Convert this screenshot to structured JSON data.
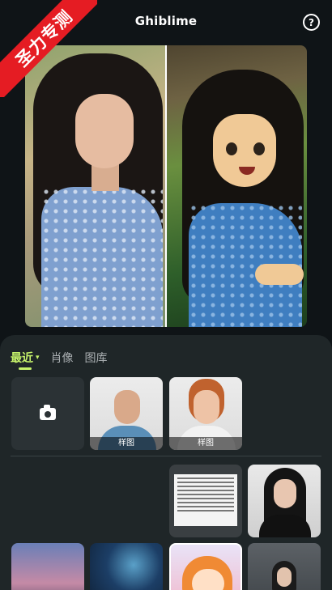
{
  "app": {
    "title": "Ghiblime",
    "help_label": "?"
  },
  "ribbon": {
    "text": "圣力专测"
  },
  "tabs": [
    {
      "label": "最近",
      "active": true,
      "caret": "▾"
    },
    {
      "label": "肖像",
      "active": false
    },
    {
      "label": "图库",
      "active": false
    }
  ],
  "samples": [
    {
      "caption": "样图"
    },
    {
      "caption": "样图"
    }
  ],
  "colors": {
    "accent": "#c6f36b",
    "ribbon": "#e51c23",
    "background": "#0f1417",
    "sheet": "#1f2628"
  }
}
